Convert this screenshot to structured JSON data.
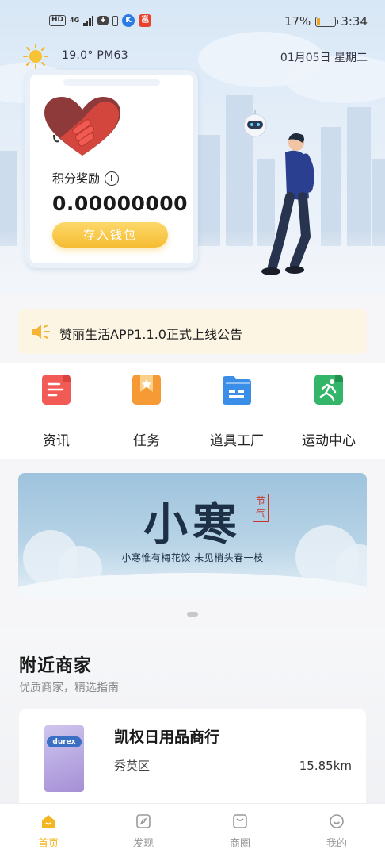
{
  "status_bar": {
    "hd": "HD",
    "network": "4G",
    "battery_percent": "17%",
    "battery_level": 0.17,
    "time": "3:34"
  },
  "weather": {
    "info": "19.0°  PM63",
    "date": "01月05日 星期二",
    "icon": "sun-icon"
  },
  "points_card": {
    "label": "积分奖励",
    "info_glyph": "!",
    "value": "0.00000000",
    "button": "存入钱包"
  },
  "announcement": {
    "text": "赞丽生活APP1.1.0正式上线公告",
    "icon": "speaker-icon"
  },
  "features": [
    {
      "label": "资讯",
      "icon": "news-icon",
      "color": "#f25a55"
    },
    {
      "label": "任务",
      "icon": "task-icon",
      "color": "#f59a35"
    },
    {
      "label": "道具工厂",
      "icon": "factory-icon",
      "color": "#3a8ee8"
    },
    {
      "label": "运动中心",
      "icon": "sport-icon",
      "color": "#33b56a"
    }
  ],
  "banner": {
    "title": "小寒",
    "seal": "节气",
    "subtitle": "小寒惟有梅花饺  未见梢头春一枝"
  },
  "nearby": {
    "title": "附近商家",
    "subtitle": "优质商家，精选指南",
    "merchants": [
      {
        "name": "凯权日用品商行",
        "area": "秀英区",
        "distance": "15.85km",
        "thumb_text": "durex"
      }
    ]
  },
  "bottom_nav": [
    {
      "label": "首页",
      "icon": "home-icon",
      "active": true
    },
    {
      "label": "发现",
      "icon": "discover-icon",
      "active": false
    },
    {
      "label": "商圈",
      "icon": "shop-icon",
      "active": false
    },
    {
      "label": "我的",
      "icon": "profile-icon",
      "active": false
    }
  ],
  "colors": {
    "accent": "#f3b620",
    "notice_bg": "#fdf5e4",
    "hero_bg": "#dce9f6"
  }
}
